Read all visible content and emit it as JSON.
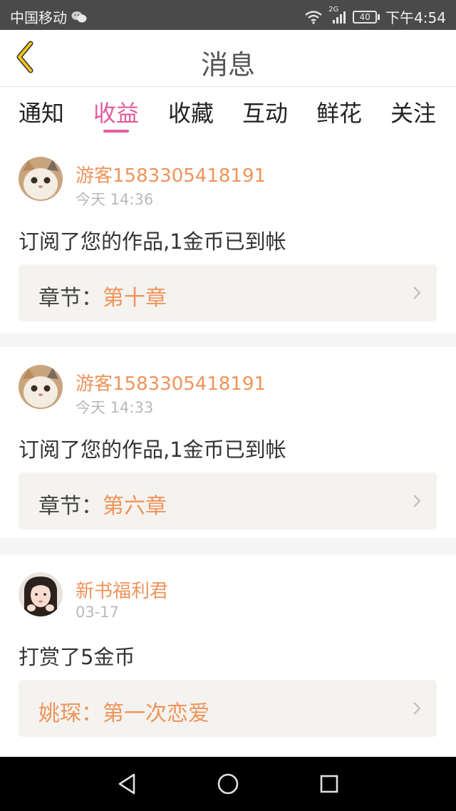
{
  "status_bar": {
    "carrier": "中国移动",
    "network": "2G",
    "battery": "40",
    "time": "下午4:54"
  },
  "header": {
    "title": "消息"
  },
  "tabs": [
    {
      "label": "通知",
      "active": false
    },
    {
      "label": "收益",
      "active": true
    },
    {
      "label": "收藏",
      "active": false
    },
    {
      "label": "互动",
      "active": false
    },
    {
      "label": "鲜花",
      "active": false
    },
    {
      "label": "关注",
      "active": false
    }
  ],
  "messages": [
    {
      "sender": "游客1583305418191",
      "time": "今天 14:36",
      "text": "订阅了您的作品,1金币已到帐",
      "link_label": "章节：",
      "link_value": "第十章"
    },
    {
      "sender": "游客1583305418191",
      "time": "今天 14:33",
      "text": "订阅了您的作品,1金币已到帐",
      "link_label": "章节：",
      "link_value": "第六章"
    },
    {
      "sender": "新书福利君",
      "time": "03-17",
      "text": "打赏了5金币",
      "link_label": "姚琛：",
      "link_value": "第一次恋爱"
    }
  ],
  "colors": {
    "accent": "#e55b9d",
    "sender": "#f0935a",
    "status_bar": "#4a4a4a",
    "back_arrow": "#e8b820"
  },
  "icons": {
    "back": "chevron-left-icon",
    "wifi": "wifi-icon",
    "signal": "signal-icon",
    "wechat": "wechat-icon",
    "nav_back": "triangle-back-icon",
    "nav_home": "circle-home-icon",
    "nav_recent": "square-recent-icon"
  }
}
